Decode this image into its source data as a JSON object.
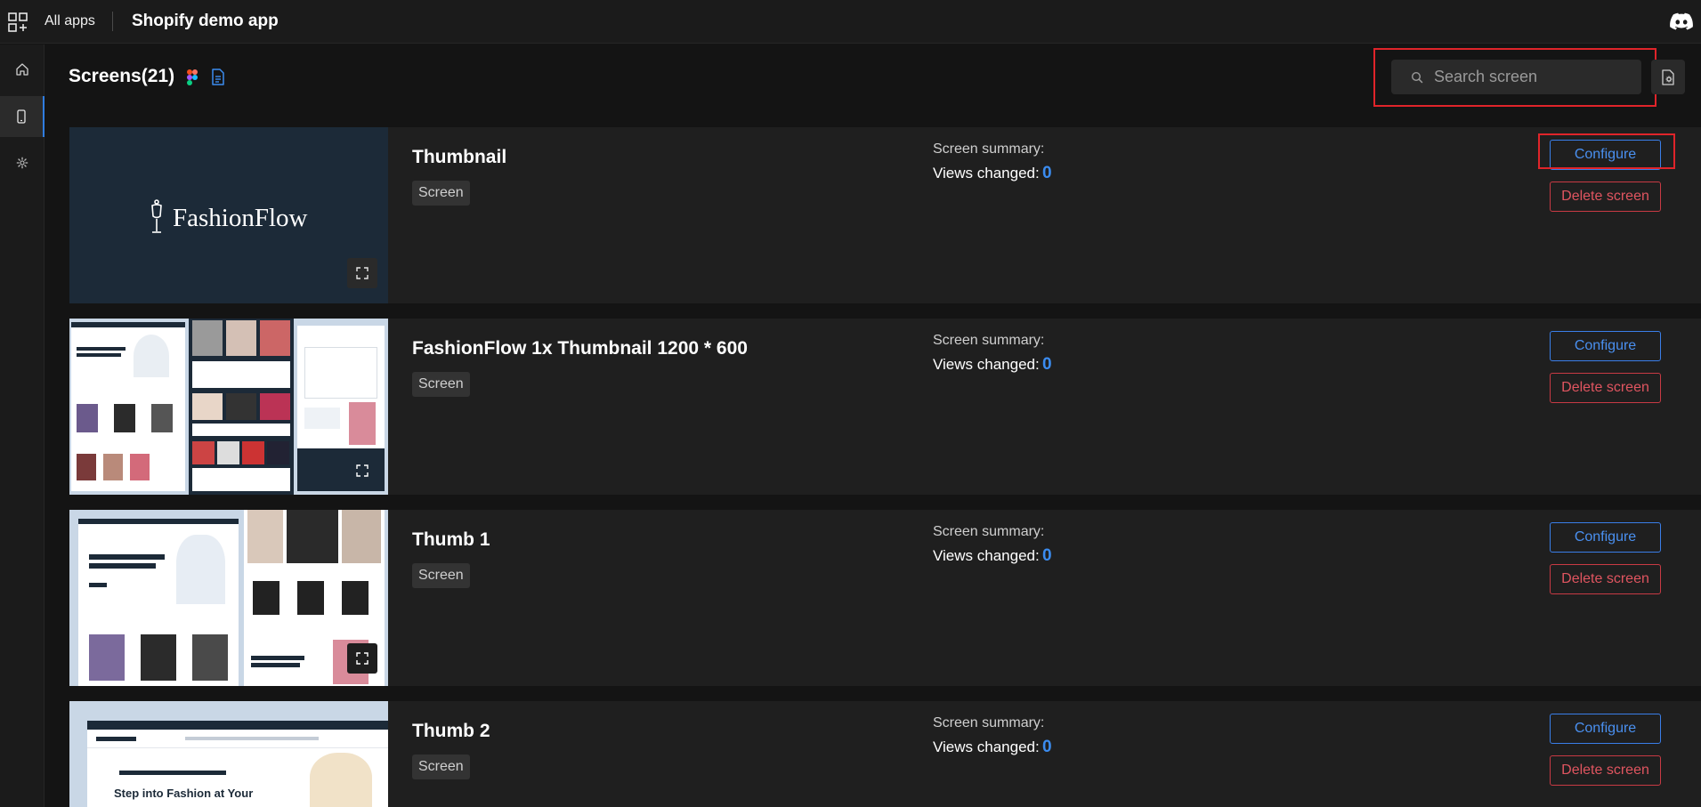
{
  "topbar": {
    "all_apps_label": "All apps",
    "app_title": "Shopify demo app",
    "apps_icon": "apps-grid-icon",
    "discord_icon": "discord-icon"
  },
  "sidebar": {
    "items": [
      {
        "name": "home-icon",
        "active": false
      },
      {
        "name": "mobile-screen-icon",
        "active": true
      },
      {
        "name": "gear-icon",
        "active": false
      }
    ]
  },
  "header": {
    "title": "Screens(21)"
  },
  "search": {
    "placeholder": "Search screen",
    "value": ""
  },
  "labels": {
    "summary": "Screen summary:",
    "views_changed": "Views changed:",
    "configure": "Configure",
    "delete": "Delete screen",
    "chip": "Screen"
  },
  "screens": [
    {
      "title": "Thumbnail",
      "views_changed": "0",
      "thumb_logo": "FashionFlow"
    },
    {
      "title": "FashionFlow 1x Thumbnail 1200 * 600",
      "views_changed": "0"
    },
    {
      "title": "Thumb 1",
      "views_changed": "0"
    },
    {
      "title": "Thumb 2",
      "views_changed": "0",
      "thumb_heading": "Step into Fashion at Your"
    }
  ],
  "colors": {
    "accent": "#3b8cf0",
    "danger": "#e05560",
    "highlight": "#e0242a",
    "thumb_navy": "#1c2a38"
  }
}
